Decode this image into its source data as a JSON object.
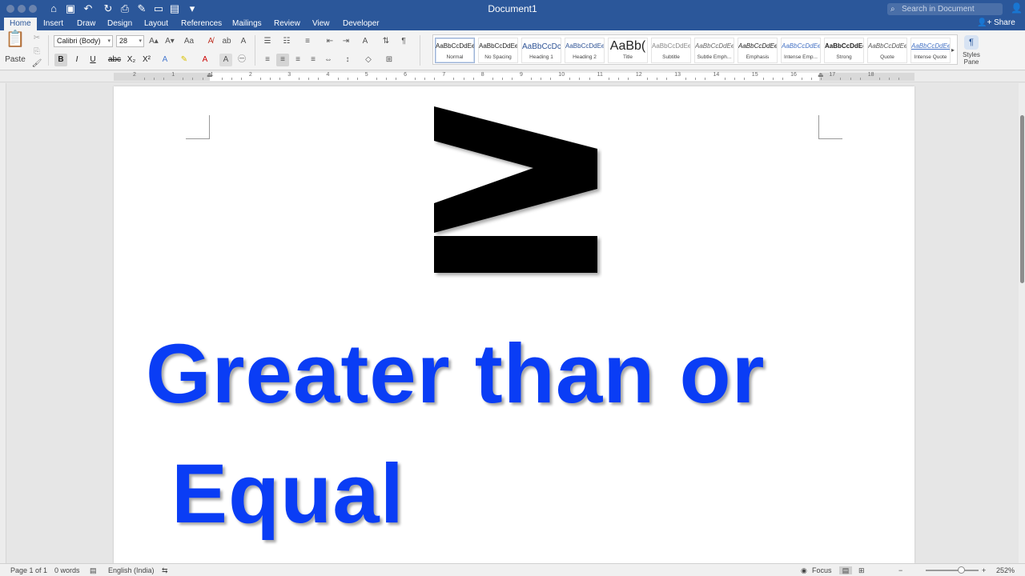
{
  "window": {
    "title": "Document1"
  },
  "titlebar": {
    "search_placeholder": "Search in Document",
    "icons": [
      "home-icon",
      "save-icon",
      "undo-icon",
      "redo-icon",
      "print-icon",
      "edit-icon",
      "new-doc-icon",
      "open-icon",
      "customize-icon",
      "user-icon"
    ]
  },
  "tabs": [
    "Home",
    "Insert",
    "Draw",
    "Design",
    "Layout",
    "References",
    "Mailings",
    "Review",
    "View",
    "Developer"
  ],
  "active_tab": "Home",
  "share_label": "Share",
  "ribbon": {
    "paste_label": "Paste",
    "font_name": "Calibri (Body)",
    "font_size": "28",
    "bold": "B",
    "italic": "I",
    "underline": "U",
    "strikethrough": "abc",
    "subscript": "X₂",
    "superscript": "X²",
    "styles": [
      {
        "sample": "AaBbCcDdEe",
        "name": "Normal"
      },
      {
        "sample": "AaBbCcDdEe",
        "name": "No Spacing"
      },
      {
        "sample": "AaBbCcDc",
        "name": "Heading 1"
      },
      {
        "sample": "AaBbCcDdEe",
        "name": "Heading 2"
      },
      {
        "sample": "AaBb(",
        "name": "Title"
      },
      {
        "sample": "AaBbCcDdEe",
        "name": "Subtitle"
      },
      {
        "sample": "AaBbCcDdEe",
        "name": "Subtle Emph..."
      },
      {
        "sample": "AaBbCcDdEe",
        "name": "Emphasis"
      },
      {
        "sample": "AaBbCcDdEe",
        "name": "Intense Emp..."
      },
      {
        "sample": "AaBbCcDdEe",
        "name": "Strong"
      },
      {
        "sample": "AaBbCcDdEe",
        "name": "Quote"
      },
      {
        "sample": "AaBbCcDdEe",
        "name": "Intense Quote"
      }
    ],
    "styles_pane_label": "Styles Pane"
  },
  "ruler": {
    "numbers": [
      "2",
      "1",
      "1",
      "2",
      "3",
      "4",
      "5",
      "6",
      "7",
      "8",
      "9",
      "10",
      "11",
      "12",
      "13",
      "14",
      "15",
      "16",
      "17",
      "18"
    ]
  },
  "document": {
    "symbol": "≥",
    "line1": "Greater than or",
    "line2": "Equal",
    "text_color": "#0a3df5"
  },
  "status": {
    "page": "Page 1 of 1",
    "words": "0 words",
    "language": "English (India)",
    "focus": "Focus",
    "zoom": "252%"
  },
  "colors": {
    "accent": "#2b579a"
  }
}
